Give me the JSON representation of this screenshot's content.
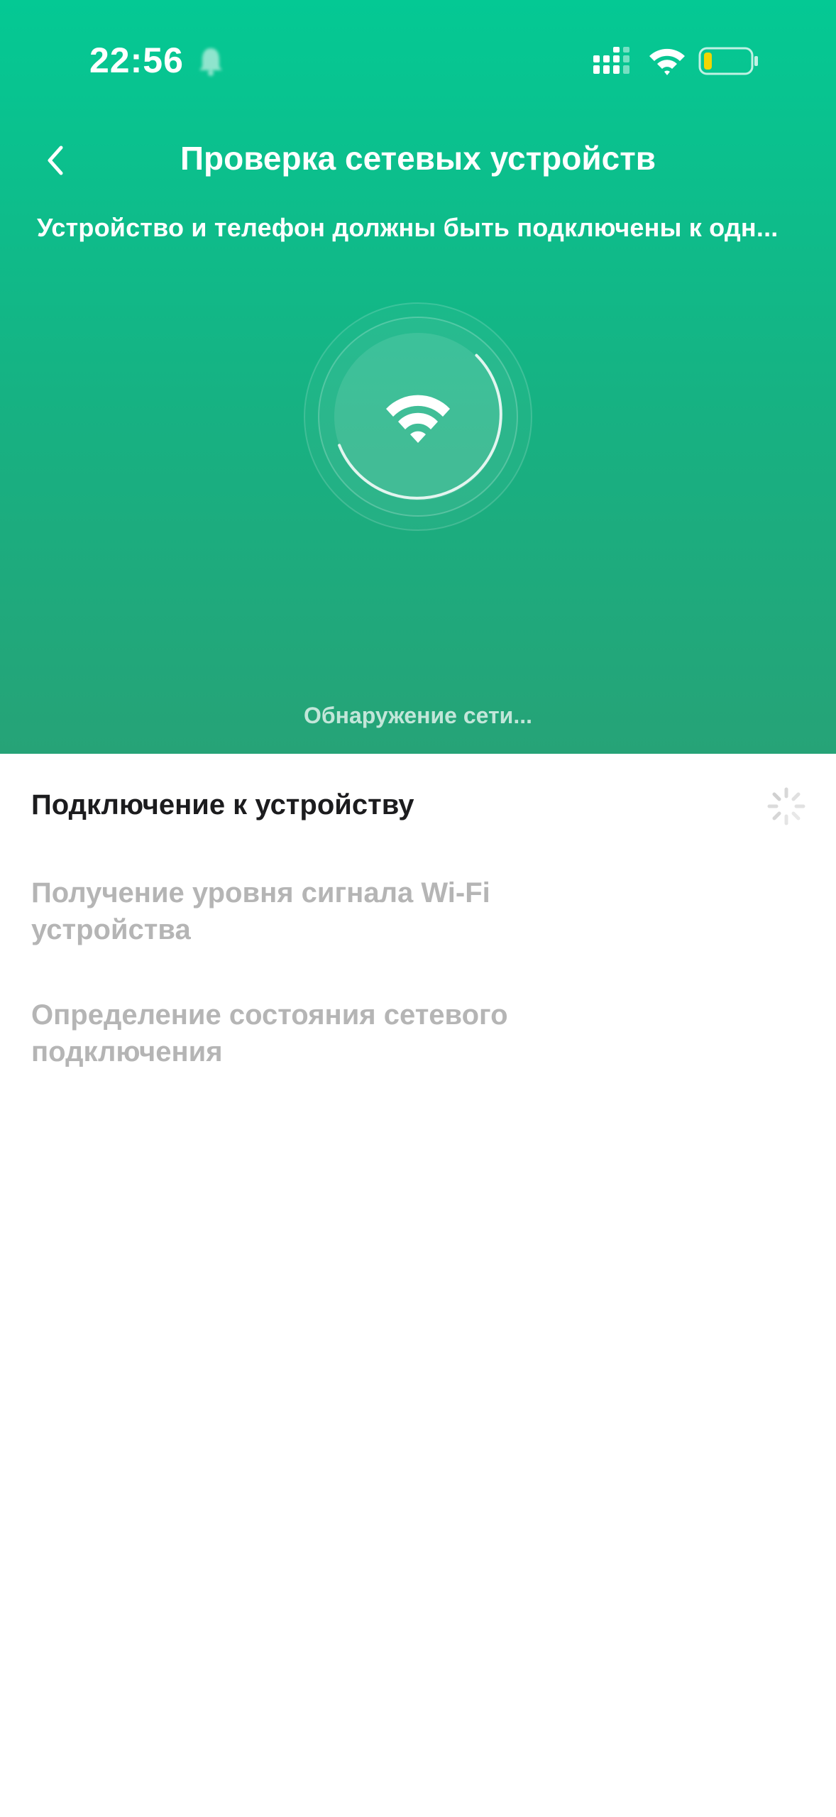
{
  "status_bar": {
    "time": "22:56",
    "bell_icon": "bell-icon",
    "signal_icon": "cellular-signal-icon",
    "wifi_icon": "wifi-icon",
    "battery_icon": "battery-low-icon",
    "battery_color": "#f2d600"
  },
  "nav": {
    "back_icon": "chevron-left-icon",
    "title": "Проверка сетевых устройств"
  },
  "subtitle": "Устройство и телефон должны быть подключены к одн...",
  "scanner": {
    "icon": "wifi-icon",
    "status": "Обнаружение сети..."
  },
  "steps": [
    {
      "label": "Подключение к устройству",
      "state": "active"
    },
    {
      "label": "Получение уровня сигнала Wi-Fi устройства",
      "state": "pending"
    },
    {
      "label": "Определение состояния сетевого подключения",
      "state": "pending"
    }
  ],
  "colors": {
    "gradient_top": "#04c994",
    "gradient_bottom": "#26a377",
    "active_text": "#1c1c1e",
    "pending_text": "#b5b5b5"
  }
}
